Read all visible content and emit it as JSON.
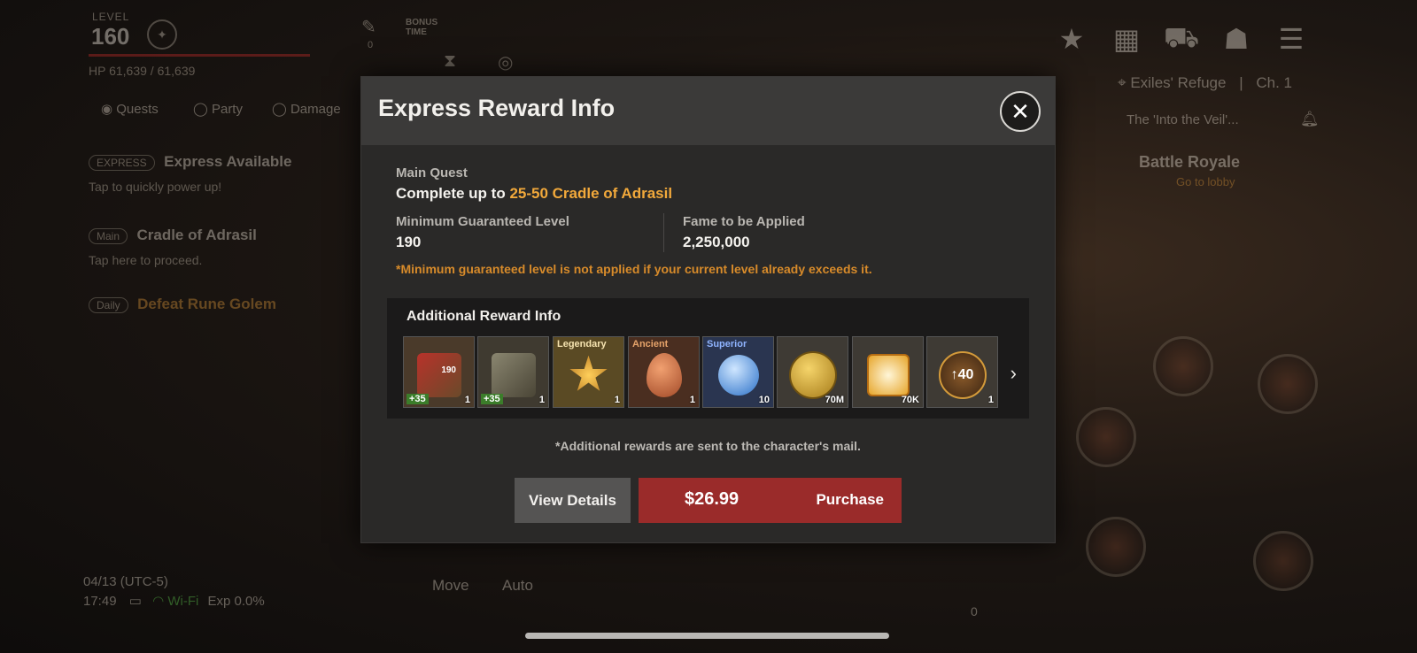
{
  "hud": {
    "level_label": "LEVEL",
    "level_value": "160",
    "hp_text": "HP 61,639 / 61,639",
    "bonus_label": "BONUS TIME",
    "counter": "0",
    "tabs": [
      "Quests",
      "Party",
      "Damage"
    ],
    "express_tag": "EXPRESS",
    "express_title": "Express Available",
    "express_sub": "Tap to quickly power up!",
    "main_tag": "Main",
    "main_title": "Cradle of Adrasil",
    "main_sub": "Tap here to proceed.",
    "daily_tag": "Daily",
    "daily_title": "Defeat Rune Golem",
    "location": "Exiles' Refuge",
    "channel": "Ch. 1",
    "notice": "The 'Into the Veil'...",
    "battle_title": "Battle Royale",
    "battle_sub": "Go to lobby",
    "datetime": "04/13 (UTC-5)",
    "clock": "17:49",
    "wifi": "Wi-Fi",
    "exp": "Exp 0.0%",
    "move": "Move",
    "auto": "Auto",
    "bottom_zero": "0"
  },
  "modal": {
    "title": "Express Reward Info",
    "close_icon": "close-icon",
    "main_quest_label": "Main Quest",
    "complete_prefix": "Complete up to ",
    "complete_highlight": "25-50 Cradle of Adrasil",
    "min_level_label": "Minimum Guaranteed Level",
    "min_level_value": "190",
    "fame_label": "Fame to be Applied",
    "fame_value": "2,250,000",
    "level_note": "*Minimum guaranteed level is not applied if your current level already exceeds it.",
    "rewards_title": "Additional Reward Info",
    "items": [
      {
        "tag": "",
        "qty": "1",
        "badge": "+35",
        "overlay": "190"
      },
      {
        "tag": "",
        "qty": "1",
        "badge": "+35",
        "overlay": ""
      },
      {
        "tag": "Legendary",
        "qty": "1",
        "badge": "",
        "overlay": ""
      },
      {
        "tag": "Ancient",
        "qty": "1",
        "badge": "",
        "overlay": ""
      },
      {
        "tag": "Superior",
        "qty": "10",
        "badge": "",
        "overlay": ""
      },
      {
        "tag": "",
        "qty": "70M",
        "badge": "",
        "overlay": ""
      },
      {
        "tag": "",
        "qty": "70K",
        "badge": "",
        "overlay": ""
      },
      {
        "tag": "",
        "qty": "1",
        "badge": "",
        "overlay": "40"
      }
    ],
    "mail_note": "*Additional rewards are sent to the character's mail.",
    "view_details": "View Details",
    "price": "$26.99",
    "purchase": "Purchase"
  },
  "colors": {
    "highlight": "#f2a93b",
    "purchase_button": "#9a2b2a",
    "note": "#d88b2a"
  }
}
